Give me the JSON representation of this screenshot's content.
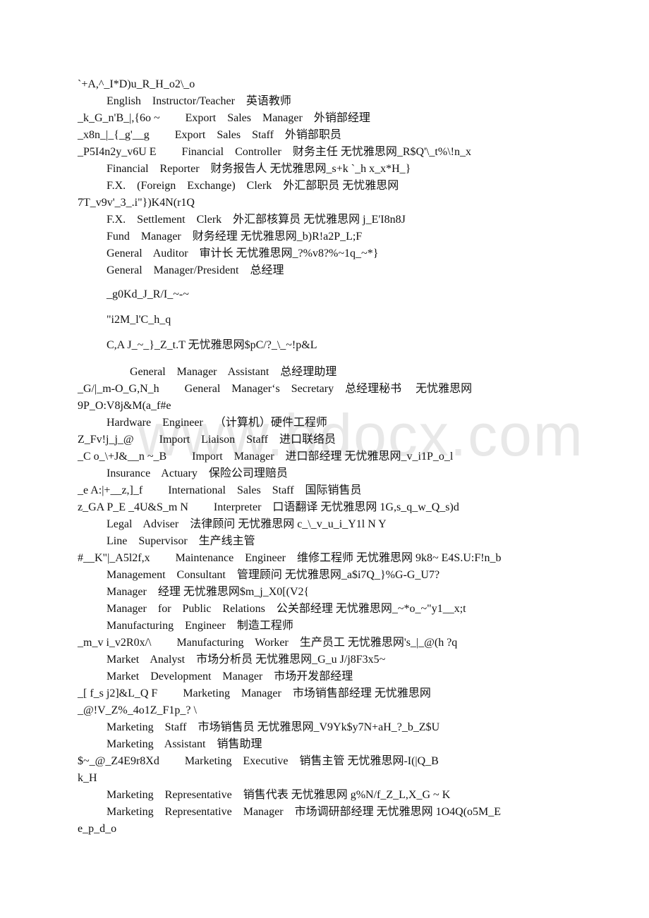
{
  "watermark": "www.bdocx.com",
  "watermark_color": "#bebebe",
  "lines": [
    {
      "text": "`+A,^_I*D)u_R_H_o2\\_o",
      "indent": 0
    },
    {
      "text": "English    Instructor/Teacher    英语教师",
      "indent": 1
    },
    {
      "text": "_k_G_n'B_|,{6o ~         Export    Sales    Manager    外销部经理",
      "indent": 0
    },
    {
      "text": "_x8n_|_{_g'__g         Export    Sales    Staff    外销部职员",
      "indent": 0
    },
    {
      "text": "_P5I4n2y_v6U E         Financial    Controller    财务主任 无忧雅思网_R$Q'\\_t%\\!n_x",
      "indent": 0
    },
    {
      "text": "Financial    Reporter    财务报告人 无忧雅思网_s+k `_h x_x*H_}",
      "indent": 1
    },
    {
      "text": "F.X.    (Foreign    Exchange)    Clerk    外汇部职员 无忧雅思网",
      "indent": 1
    },
    {
      "text": "7T_v9v'_3_.i\"})K4N(r1Q",
      "indent": 0
    },
    {
      "text": "F.X.    Settlement    Clerk    外汇部核算员 无忧雅思网 j_E'I8n8J",
      "indent": 1
    },
    {
      "text": "Fund    Manager    财务经理 无忧雅思网_b)R!a2P_L;F",
      "indent": 1
    },
    {
      "text": "General    Auditor    审计长 无忧雅思网_?%v8?%~1q_~*}",
      "indent": 1
    },
    {
      "text": "General    Manager/President    总经理",
      "indent": 1
    },
    {
      "text": "_g0Kd_J_R/I_~-~",
      "indent": 1
    },
    {
      "text": "\"i2M_l'C_h_q",
      "indent": 1
    },
    {
      "text": "C,A J_~_}_Z_t.T 无忧雅思网$pC/?_\\_~!p&L",
      "indent": 1
    },
    {
      "text": "General    Manager    Assistant    总经理助理",
      "indent": 2
    },
    {
      "text": "_G/|_m-O_G,N_h         General    Manager‘s    Secretary    总经理秘书     无忧雅思网",
      "indent": 0
    },
    {
      "text": "9P_O:V8j&M(a_f#e",
      "indent": 0
    },
    {
      "text": "Hardware    Engineer    （计算机）硬件工程师",
      "indent": 1
    },
    {
      "text": "Z_Fv!j_j_@         Import    Liaison    Staff    进口联络员",
      "indent": 0
    },
    {
      "text": "_C o_\\+J&__n ~_B         Import    Manager    进口部经理 无忧雅思网_v_i1P_o_l",
      "indent": 0
    },
    {
      "text": "Insurance    Actuary    保险公司理赔员",
      "indent": 1
    },
    {
      "text": "_e A:|+__z,]_f         International    Sales    Staff    国际销售员",
      "indent": 0
    },
    {
      "text": "z_GA P_E _4U&S_m N         Interpreter    口语翻译 无忧雅思网 1G,s_q_w_Q_s)d",
      "indent": 0
    },
    {
      "text": "Legal    Adviser    法律顾问 无忧雅思网 c_\\_v_u_i_Y1l N Y",
      "indent": 1
    },
    {
      "text": "Line    Supervisor    生产线主管",
      "indent": 1
    },
    {
      "text": "#__K\"|_A5l2f,x         Maintenance    Engineer    维修工程师 无忧雅思网 9k8~ E4S.U:F!n_b",
      "indent": 0
    },
    {
      "text": "Management    Consultant    管理顾问 无忧雅思网_a$i7Q_}%G-G_U7?",
      "indent": 1
    },
    {
      "text": "Manager    经理 无忧雅思网$m_j_X0[(V2{",
      "indent": 1
    },
    {
      "text": "Manager    for    Public    Relations    公关部经理 无忧雅思网_~*o_~\"y1__x;t",
      "indent": 1
    },
    {
      "text": "Manufacturing    Engineer    制造工程师",
      "indent": 1
    },
    {
      "text": "_m_v i_v2R0x/\\         Manufacturing    Worker    生产员工 无忧雅思网's_|_@(h ?q",
      "indent": 0
    },
    {
      "text": "Market    Analyst    市场分析员 无忧雅思网_G_u J/j8F3x5~",
      "indent": 1
    },
    {
      "text": "Market    Development    Manager    市场开发部经理",
      "indent": 1
    },
    {
      "text": "_[ f_s j2]&L_Q F         Marketing    Manager    市场销售部经理 无忧雅思网",
      "indent": 0
    },
    {
      "text": "_@!V_Z%_4o1Z_F1p_? \\",
      "indent": 0
    },
    {
      "text": "Marketing    Staff    市场销售员 无忧雅思网_V9Yk$y7N+aH_?_b_Z$U",
      "indent": 1
    },
    {
      "text": "Marketing    Assistant    销售助理",
      "indent": 1
    },
    {
      "text": "$~_@_Z4E9r8Xd         Marketing    Executive    销售主管 无忧雅思网-I(|Q_B",
      "indent": 0
    },
    {
      "text": "k_H",
      "indent": 0
    },
    {
      "text": "Marketing    Representative    销售代表 无忧雅思网 g%N/f_Z_L,X_G ~ K",
      "indent": 1
    },
    {
      "text": "Marketing    Representative    Manager    市场调研部经理 无忧雅思网 1O4Q(o5M_E",
      "indent": 1
    },
    {
      "text": "e_p_d_o",
      "indent": 0
    }
  ]
}
